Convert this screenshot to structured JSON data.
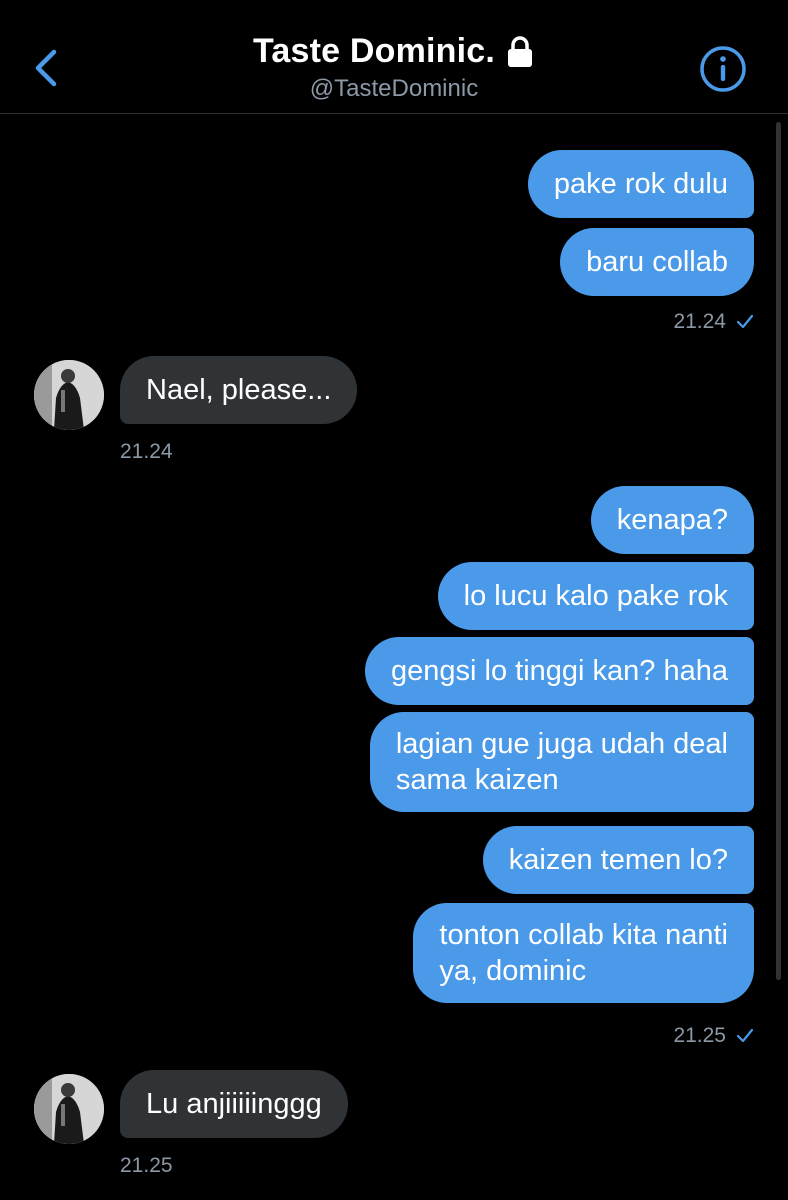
{
  "header": {
    "title": "Taste Dominic.",
    "handle": "@TasteDominic",
    "back_icon": "chevron-left-icon",
    "lock_icon": "lock-icon",
    "info_icon": "info-icon"
  },
  "colors": {
    "accent": "#4a9ae9",
    "incoming_bubble": "#2f3336",
    "timestamp": "#8b98a5"
  },
  "messages": {
    "group1": [
      "pake rok dulu",
      "baru collab"
    ],
    "group1_time": "21.24",
    "incoming1": "Nael, please...",
    "incoming1_time": "21.24",
    "group2": [
      "kenapa?",
      "lo lucu kalo pake rok",
      "gengsi lo tinggi kan? haha",
      "lagian gue juga udah deal",
      "sama kaizen",
      "kaizen temen lo?",
      "tonton collab kita nanti",
      "ya, dominic"
    ],
    "group2_time": "21.25",
    "incoming2": "Lu anjiiiiinggg",
    "incoming2_time": "21.25"
  }
}
